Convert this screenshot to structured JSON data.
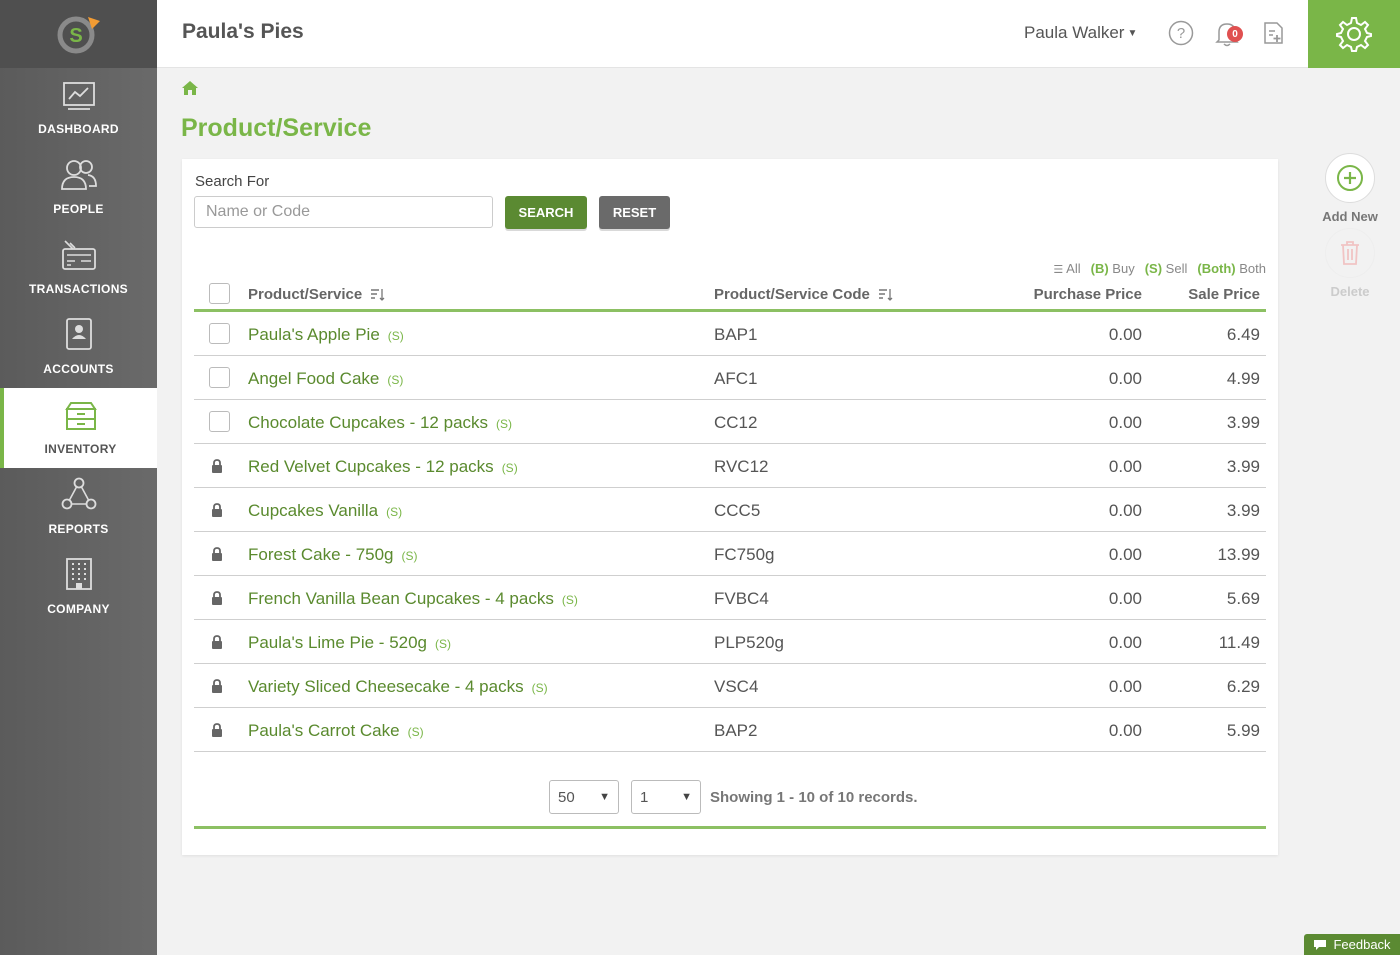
{
  "app": {
    "company_name": "Paula's Pies",
    "user_name": "Paula Walker",
    "notification_count": "0",
    "accent_color": "#7ab648"
  },
  "sidebar": {
    "items": [
      {
        "label": "DASHBOARD",
        "icon": "dashboard-chart-icon"
      },
      {
        "label": "PEOPLE",
        "icon": "people-icon"
      },
      {
        "label": "TRANSACTIONS",
        "icon": "transactions-icon"
      },
      {
        "label": "ACCOUNTS",
        "icon": "accounts-icon"
      },
      {
        "label": "INVENTORY",
        "icon": "inventory-icon",
        "active": true
      },
      {
        "label": "REPORTS",
        "icon": "reports-network-icon"
      },
      {
        "label": "COMPANY",
        "icon": "company-building-icon"
      }
    ]
  },
  "page": {
    "title": "Product/Service"
  },
  "search": {
    "label": "Search For",
    "placeholder": "Name or Code",
    "value": "",
    "search_button": "SEARCH",
    "reset_button": "RESET"
  },
  "filters": {
    "all": "All",
    "buy_key": "(B)",
    "buy": "Buy",
    "sell_key": "(S)",
    "sell": "Sell",
    "both_key": "(Both)",
    "both": "Both"
  },
  "table": {
    "headers": {
      "name": "Product/Service",
      "code": "Product/Service Code",
      "purchase": "Purchase Price",
      "sale": "Sale Price"
    },
    "rows": [
      {
        "name": "Paula's Apple Pie",
        "type": "(S)",
        "code": "BAP1",
        "purchase": "0.00",
        "sale": "6.49",
        "locked": false
      },
      {
        "name": "Angel Food Cake",
        "type": "(S)",
        "code": "AFC1",
        "purchase": "0.00",
        "sale": "4.99",
        "locked": false
      },
      {
        "name": "Chocolate Cupcakes - 12 packs",
        "type": "(S)",
        "code": "CC12",
        "purchase": "0.00",
        "sale": "3.99",
        "locked": false
      },
      {
        "name": "Red Velvet Cupcakes - 12 packs",
        "type": "(S)",
        "code": "RVC12",
        "purchase": "0.00",
        "sale": "3.99",
        "locked": true
      },
      {
        "name": "Cupcakes Vanilla",
        "type": "(S)",
        "code": "CCC5",
        "purchase": "0.00",
        "sale": "3.99",
        "locked": true
      },
      {
        "name": "Forest Cake - 750g",
        "type": "(S)",
        "code": "FC750g",
        "purchase": "0.00",
        "sale": "13.99",
        "locked": true
      },
      {
        "name": "French Vanilla Bean Cupcakes - 4 packs",
        "type": "(S)",
        "code": "FVBC4",
        "purchase": "0.00",
        "sale": "5.69",
        "locked": true
      },
      {
        "name": "Paula's Lime Pie - 520g",
        "type": "(S)",
        "code": "PLP520g",
        "purchase": "0.00",
        "sale": "11.49",
        "locked": true
      },
      {
        "name": "Variety Sliced Cheesecake - 4 packs",
        "type": "(S)",
        "code": "VSC4",
        "purchase": "0.00",
        "sale": "6.29",
        "locked": true
      },
      {
        "name": "Paula's Carrot Cake",
        "type": "(S)",
        "code": "BAP2",
        "purchase": "0.00",
        "sale": "5.99",
        "locked": true
      }
    ]
  },
  "pagination": {
    "page_size": "50",
    "page_number": "1",
    "summary": "Showing 1 - 10 of 10 records."
  },
  "actions": {
    "add_new": "Add New",
    "delete": "Delete"
  },
  "feedback": "Feedback"
}
